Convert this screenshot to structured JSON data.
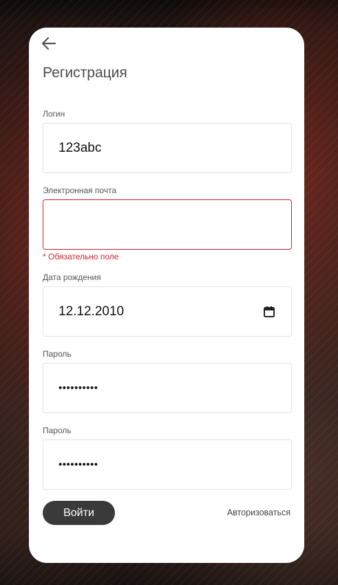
{
  "form": {
    "title": "Регистрация",
    "login": {
      "label": "Логин",
      "value": "123abc"
    },
    "email": {
      "label": "Электронная почта",
      "value": "",
      "error": "* Обязательно поле"
    },
    "birthdate": {
      "label": "Дата рождения",
      "value": "12.12.2010"
    },
    "password": {
      "label": "Пароль",
      "value": "••••••••••"
    },
    "password_confirm": {
      "label": "Пароль",
      "value": "••••••••••"
    },
    "submit_label": "Войти",
    "login_link": "Авторизоваться"
  },
  "colors": {
    "accent": "#3a3a3a",
    "error": "#d0202a",
    "card": "#ffffff"
  },
  "icons": {
    "back": "arrow-left-icon",
    "calendar": "calendar-icon"
  }
}
